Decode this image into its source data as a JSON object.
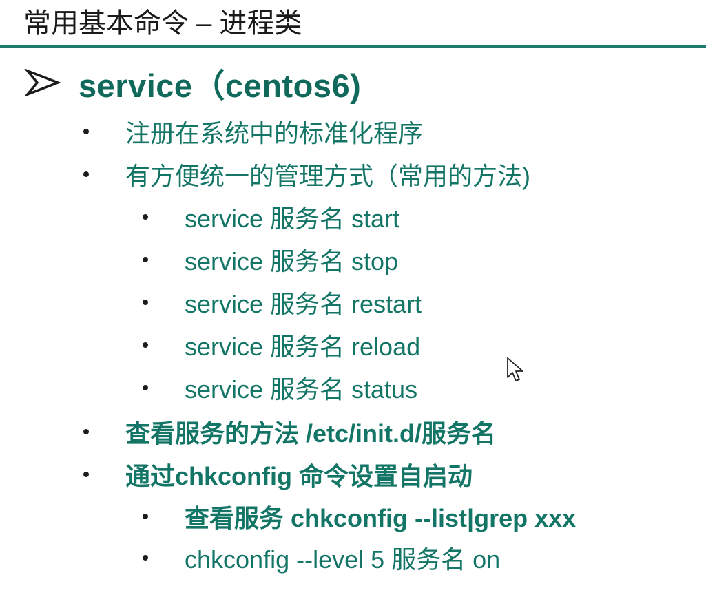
{
  "slide": {
    "title": "常用基本命令 – 进程类",
    "heading": "service（centos6)",
    "items": [
      {
        "level": 1,
        "bold": false,
        "text": "注册在系统中的标准化程序"
      },
      {
        "level": 1,
        "bold": false,
        "text": "有方便统一的管理方式（常用的方法)"
      },
      {
        "level": 2,
        "bold": false,
        "text": "service  服务名 start"
      },
      {
        "level": 2,
        "bold": false,
        "text": "service  服务名 stop"
      },
      {
        "level": 2,
        "bold": false,
        "text": "service  服务名 restart"
      },
      {
        "level": 2,
        "bold": false,
        "text": "service  服务名 reload"
      },
      {
        "level": 2,
        "bold": false,
        "text": "service  服务名 status"
      },
      {
        "level": 1,
        "bold": true,
        "text": "查看服务的方法  /etc/init.d/服务名"
      },
      {
        "level": 1,
        "bold": true,
        "text": "通过chkconfig 命令设置自启动"
      },
      {
        "level": 2,
        "bold": true,
        "text": "查看服务 chkconfig    --list|grep  xxx"
      },
      {
        "level": 2,
        "bold": false,
        "text": "chkconfig   --level  5   服务名   on"
      }
    ]
  },
  "colors": {
    "accent": "#137566",
    "heading": "#11695c",
    "rule": "#1e7a6c",
    "title": "#1a1a1a",
    "bullet": "#1c1c1c"
  },
  "icons": {
    "heading_bullet": "arrowhead-bullet-icon",
    "pointer": "mouse-cursor-icon"
  }
}
